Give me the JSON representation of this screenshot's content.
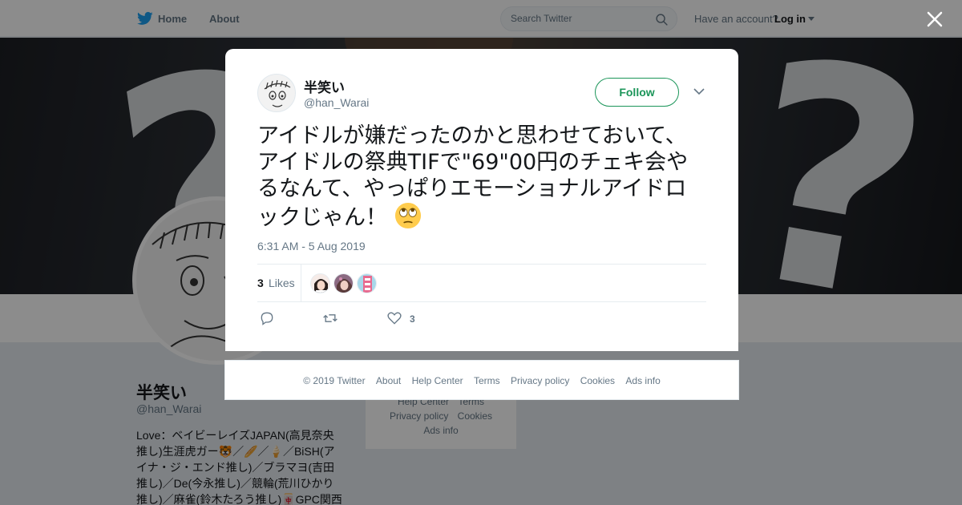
{
  "nav": {
    "home_label": "Home",
    "about_label": "About",
    "search_placeholder": "Search Twitter",
    "have_account": "Have an account?",
    "login_label": "Log in",
    "brand_color": "#1da1f2",
    "brand_icon": "bird-logo-icon",
    "search_icon": "search-icon"
  },
  "banner": {
    "description_icon": "question-mark-banner"
  },
  "profile": {
    "name": "半笑い",
    "handle": "@han_Warai",
    "bio_lines": [
      "Love：ベイビーレイズJAPAN(高見奈央",
      "推し)生涯虎ガー🐯／🥖／🍦／BiSH(ア",
      "イナ・ジ・エンド推し)／ブラマヨ(吉田",
      "推し)／De(今永推し)／競輪(荒川ひかり",
      "推し)／麻雀(鈴木たろう推し)🀄GPC関西"
    ]
  },
  "side_links": {
    "row1": [
      "Help Center",
      "Terms"
    ],
    "row2": [
      "Privacy policy",
      "Cookies"
    ],
    "row3": [
      "Ads info"
    ]
  },
  "tweet": {
    "author_name": "半笑い",
    "author_handle": "@han_Warai",
    "follow_label": "Follow",
    "accent_color": "#1b9559",
    "text": "アイドルが嫌だったのかと思わせておいて、アイドルの祭典TIFで\"69\"00円のチェキ会やるなんて、やっぱりエモーショナルアイドロックじゃん！",
    "emoji": "face-with-rolling-eyes-emoji",
    "timestamp": "6:31 AM - 5 Aug 2019",
    "likes_count": "3",
    "likes_label": "Likes",
    "heart_count": "3"
  },
  "footer": {
    "links": [
      "© 2019 Twitter",
      "About",
      "Help Center",
      "Terms",
      "Privacy policy",
      "Cookies",
      "Ads info"
    ]
  }
}
